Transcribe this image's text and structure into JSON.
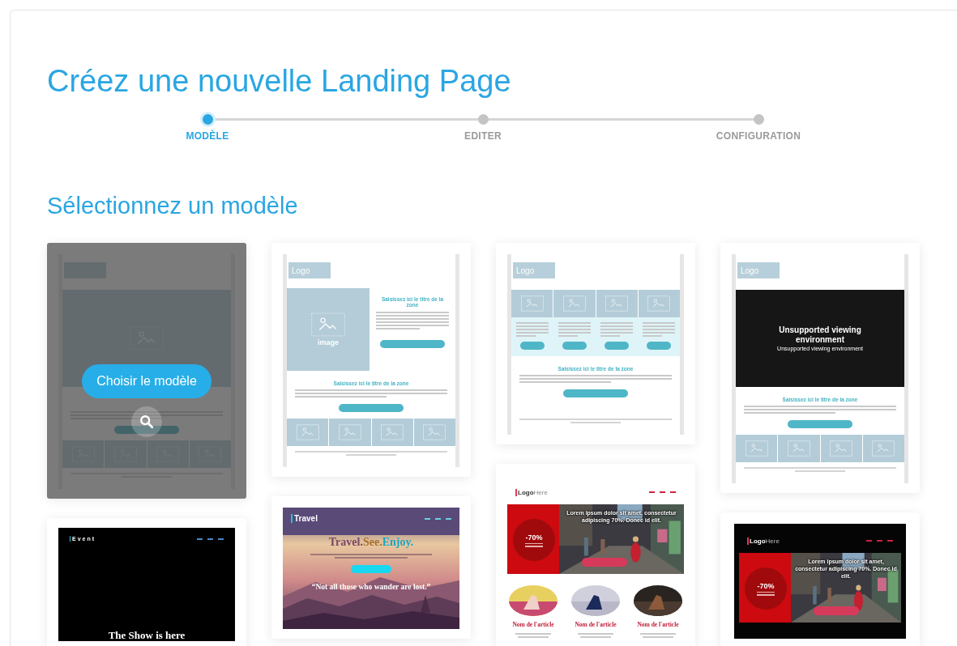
{
  "heading": "Créez une nouvelle Landing Page",
  "steps": [
    {
      "label": "MODÈLE",
      "selected": true
    },
    {
      "label": "EDITER",
      "selected": false
    },
    {
      "label": "CONFIGURATION",
      "selected": false
    }
  ],
  "section_title": "Sélectionnez un modèle",
  "hover_action": {
    "label": "Choisir le modèle"
  },
  "columns": [
    [
      {
        "kind": "hero",
        "hovered": true
      },
      {
        "kind": "event",
        "hovered": false,
        "brand": "Event",
        "headline": "The Show is here"
      }
    ],
    [
      {
        "kind": "split",
        "hovered": false,
        "logo": "Logo",
        "image_label": "image",
        "side_title": "Saisissez ici le titre de la zone",
        "title": "Saisissez ici le titre de la zone"
      },
      {
        "kind": "travel",
        "hovered": false,
        "brand": "Travel",
        "headline": [
          {
            "text": "Travel.",
            "color": "#7a4668"
          },
          {
            "text": "See.",
            "color": "#a8702e"
          },
          {
            "text": "Enjoy.",
            "color": "#1aa6c4"
          }
        ],
        "quote": "“Not all those who wander are lost.”"
      }
    ],
    [
      {
        "kind": "columns",
        "hovered": false,
        "logo": "Logo",
        "title": "Saisissez ici le titre de la zone"
      },
      {
        "kind": "shop",
        "hovered": false,
        "dark": false,
        "logo_main": "Logo",
        "logo_accent": "Here",
        "banner_text": "Lorem ipsum dolor sit amet, consectetur adipiscing 70%. Donec id elit.",
        "discount": "-70%",
        "products": [
          "Nom de l'article",
          "Nom de l'article",
          "Nom de l'article"
        ]
      }
    ],
    [
      {
        "kind": "video",
        "hovered": false,
        "logo": "Logo",
        "video_title": "Unsupported viewing environment",
        "video_subtitle": "Unsupported viewing environment",
        "title": "Saisissez ici le titre de la zone"
      },
      {
        "kind": "shop",
        "hovered": false,
        "dark": true,
        "logo_main": "Logo",
        "logo_accent": "Here",
        "banner_text": "Lorem ipsum dolor sit amet, consectetur adipiscing 70%. Donec id elit.",
        "discount": "-70%"
      }
    ]
  ]
}
